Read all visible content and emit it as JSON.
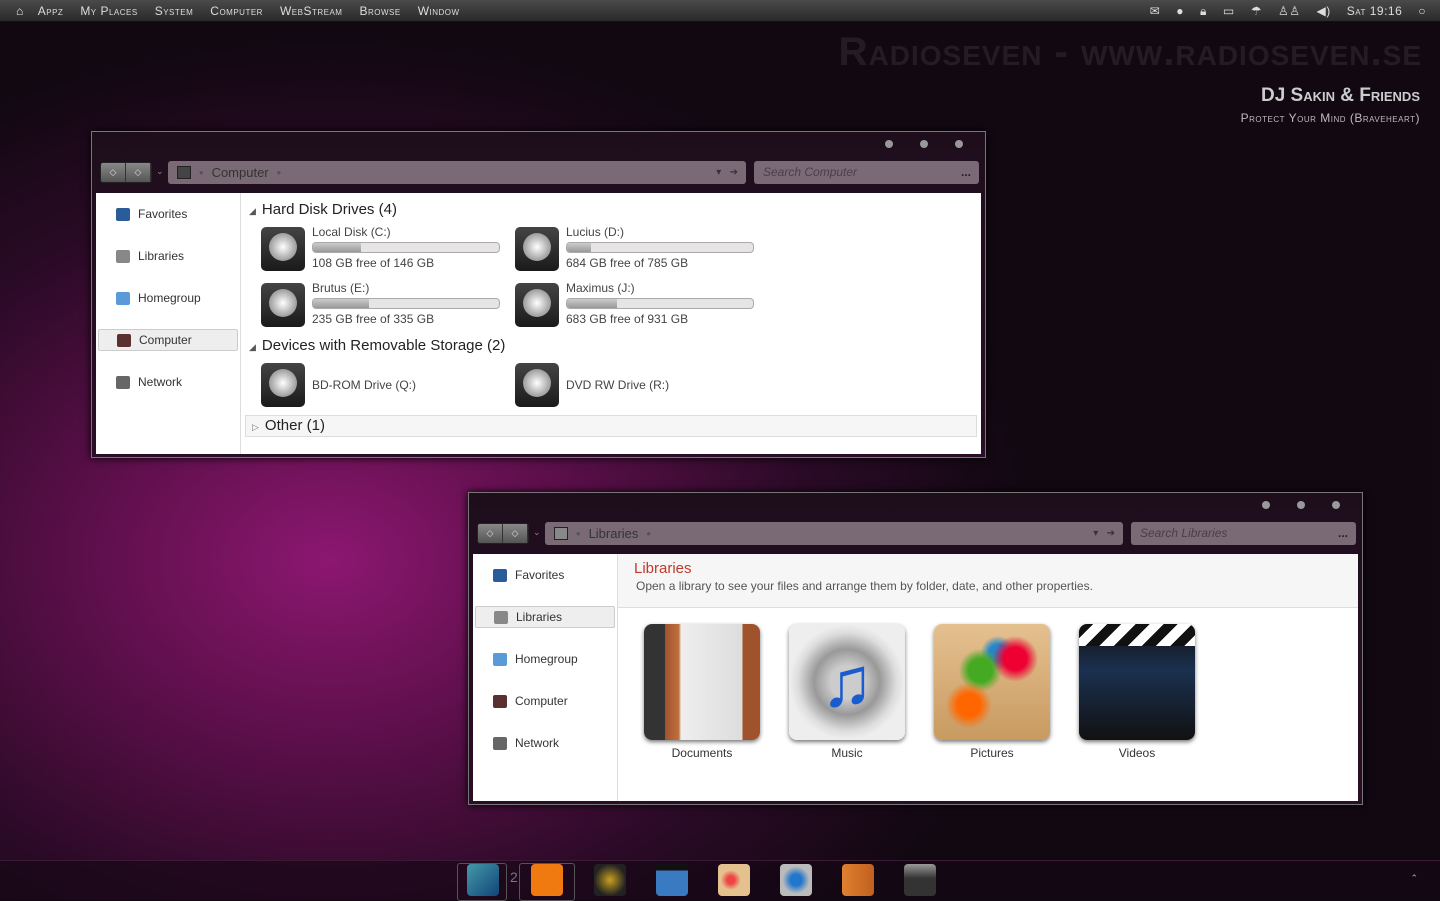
{
  "menubar": {
    "items": [
      "Appz",
      "My Places",
      "System",
      "Computer",
      "WebStream",
      "Browse",
      "Window"
    ],
    "clock": "Sat 19:16",
    "tray_icons": [
      "mail-icon",
      "chat-icon",
      "lock-icon",
      "monitor-icon",
      "network-icon",
      "users-icon",
      "volume-icon",
      "search-icon"
    ]
  },
  "wallpaper": {
    "watermark": "Radioseven - www.radioseven.se",
    "title": "DJ Sakin & Friends",
    "subtitle": "Protect Your Mind (Braveheart)"
  },
  "computer_window": {
    "address": "Computer",
    "search_placeholder": "Search Computer",
    "sidebar": [
      "Favorites",
      "Libraries",
      "Homegroup",
      "Computer",
      "Network"
    ],
    "selected": "Computer",
    "groups": {
      "hdd": "Hard Disk Drives (4)",
      "removable": "Devices with Removable Storage (2)",
      "other": "Other (1)"
    },
    "drives": [
      {
        "name": "Local Disk (C:)",
        "free": "108 GB free of 146 GB",
        "used_fraction": 0.26
      },
      {
        "name": "Lucius (D:)",
        "free": "684 GB free of 785 GB",
        "used_fraction": 0.13
      },
      {
        "name": "Brutus (E:)",
        "free": "235 GB free of 335 GB",
        "used_fraction": 0.3
      },
      {
        "name": "Maximus (J:)",
        "free": "683 GB free of 931 GB",
        "used_fraction": 0.27
      }
    ],
    "removable": [
      "BD-ROM Drive (Q:)",
      "DVD RW Drive (R:)"
    ]
  },
  "libraries_window": {
    "address": "Libraries",
    "search_placeholder": "Search Libraries",
    "sidebar": [
      "Favorites",
      "Libraries",
      "Homegroup",
      "Computer",
      "Network"
    ],
    "selected": "Libraries",
    "heading": "Libraries",
    "description": "Open a library to see your files and arrange them by folder, date, and other properties.",
    "libraries": [
      "Documents",
      "Music",
      "Pictures",
      "Videos"
    ],
    "heading_color": "#c0392b"
  },
  "dock": {
    "badge": "2",
    "apps": [
      "finder",
      "firefox-like",
      "bat-app",
      "video-player",
      "paint",
      "itunes",
      "transfer",
      "recycle-bin"
    ]
  }
}
